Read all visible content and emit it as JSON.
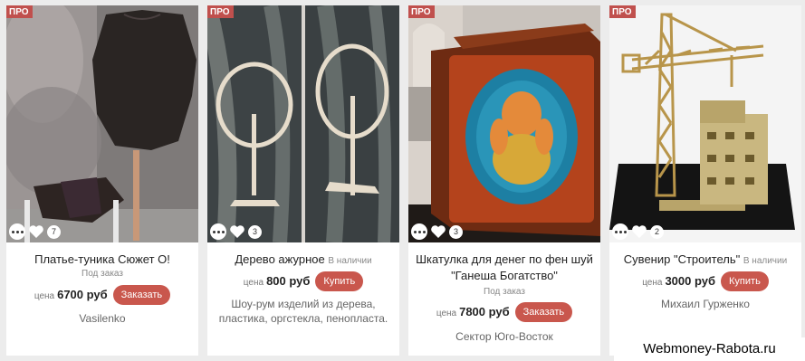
{
  "colors": {
    "badge": "#c0504d",
    "button": "#c9574d",
    "page_bg": "#ececec"
  },
  "icons": {
    "more": "more-dots-icon",
    "like": "heart-icon"
  },
  "cards": [
    {
      "badge": "ПРО",
      "likes": "7",
      "title": "Платье-туника Сюжет О!",
      "note": "Под заказ",
      "price_label": "цена",
      "price": "6700 руб",
      "button": "Заказать",
      "seller": "Vasilenko"
    },
    {
      "badge": "ПРО",
      "likes": "3",
      "title": "Дерево ажурное",
      "availability": "В наличии",
      "price_label": "цена",
      "price": "800 руб",
      "button": "Купить",
      "seller": "Шоу-рум изделий из дерева, пластика, оргстекла, пенопласта."
    },
    {
      "badge": "ПРО",
      "likes": "3",
      "title": "Шкатулка для денег по фен шуй \"Ганеша Богатство\"",
      "note": "Под заказ",
      "price_label": "цена",
      "price": "7800 руб",
      "button": "Заказать",
      "seller": "Сектор Юго-Восток"
    },
    {
      "badge": "ПРО",
      "likes": "2",
      "title": "Сувенир \"Строитель\"",
      "availability": "В наличии",
      "price_label": "цена",
      "price": "3000 руб",
      "button": "Купить",
      "seller": "Михаил Гурженко"
    }
  ],
  "watermark": "Webmoney-Rabota.ru"
}
